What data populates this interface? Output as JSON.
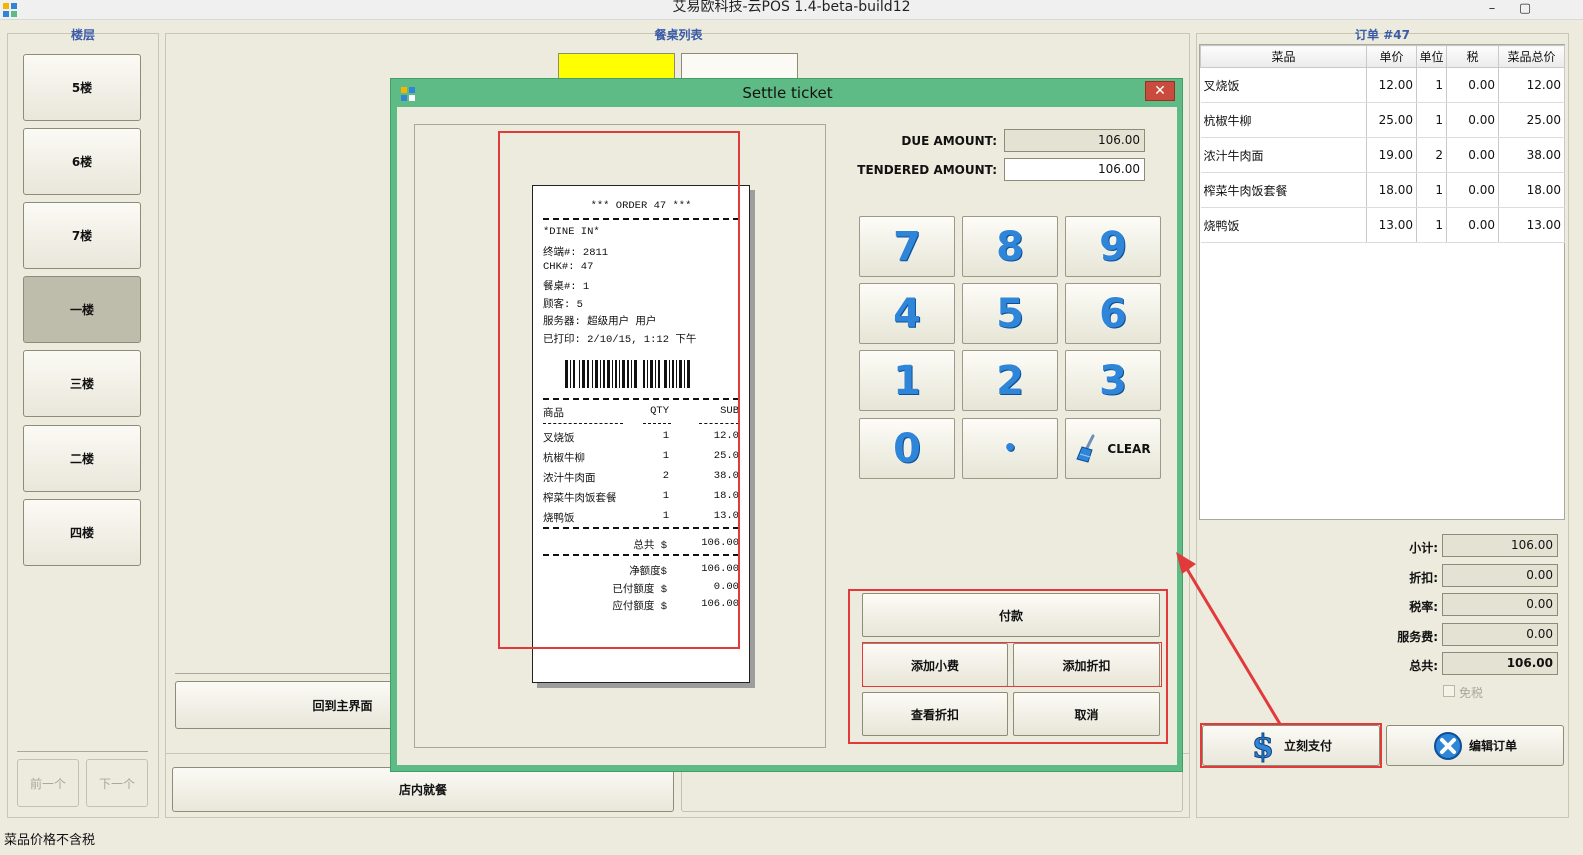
{
  "window": {
    "title": "艾易欧科技-云POS 1.4-beta-build12"
  },
  "floors": {
    "title": "楼层",
    "items": [
      "5楼",
      "6楼",
      "7楼",
      "一楼",
      "三楼",
      "二楼",
      "四楼"
    ],
    "prev_label": "前一个",
    "next_label": "下一个"
  },
  "tables": {
    "title": "餐桌列表",
    "home_label": "回到主界面",
    "dine_in_label": "店内就餐"
  },
  "order": {
    "title": "订单 #47",
    "columns": [
      "菜品",
      "单价",
      "单位",
      "税",
      "菜品总价"
    ],
    "rows": [
      {
        "name": "叉烧饭",
        "price": "12.00",
        "qty": "1",
        "tax": "0.00",
        "total": "12.00"
      },
      {
        "name": "杭椒牛柳",
        "price": "25.00",
        "qty": "1",
        "tax": "0.00",
        "total": "25.00"
      },
      {
        "name": "浓汁牛肉面",
        "price": "19.00",
        "qty": "2",
        "tax": "0.00",
        "total": "38.00"
      },
      {
        "name": "榨菜牛肉饭套餐",
        "price": "18.00",
        "qty": "1",
        "tax": "0.00",
        "total": "18.00"
      },
      {
        "name": "烧鸭饭",
        "price": "13.00",
        "qty": "1",
        "tax": "0.00",
        "total": "13.00"
      }
    ],
    "summary": {
      "subtotal_label": "小计:",
      "subtotal": "106.00",
      "discount_label": "折扣:",
      "discount": "0.00",
      "tax_label": "税率:",
      "tax": "0.00",
      "service_label": "服务费:",
      "service": "0.00",
      "total_label": "总共:",
      "total": "106.00"
    },
    "tax_exempt_label": "免税",
    "pay_now_label": "立刻支付",
    "edit_order_label": "编辑订单"
  },
  "dialog": {
    "title": "Settle ticket",
    "close_glyph": "✕",
    "due_label": "DUE AMOUNT:",
    "due_value": "106.00",
    "tendered_label": "TENDERED AMOUNT:",
    "tendered_value": "106.00",
    "keys": [
      "7",
      "8",
      "9",
      "4",
      "5",
      "6",
      "1",
      "2",
      "3",
      "0",
      "•"
    ],
    "clear_label": "CLEAR",
    "pay_label": "付款",
    "add_tip_label": "添加小费",
    "add_discount_label": "添加折扣",
    "view_discount_label": "查看折扣",
    "cancel_label": "取消"
  },
  "receipt": {
    "header": "*** ORDER 47 ***",
    "order_type": "*DINE IN*",
    "terminal": "终端#: 2811",
    "check": "CHK#: 47",
    "table": "餐桌#: 1",
    "guests": "顾客: 5",
    "server": "服务器: 超级用户 用户",
    "printed": "已打印: 2/10/15, 1:12 下午",
    "col_item": "商品",
    "col_qty": "QTY",
    "col_sub": "SUB",
    "items": [
      {
        "name": "叉烧饭",
        "qty": "1",
        "sub": "12.0"
      },
      {
        "name": "杭椒牛柳",
        "qty": "1",
        "sub": "25.0"
      },
      {
        "name": "浓汁牛肉面",
        "qty": "2",
        "sub": "38.0"
      },
      {
        "name": "榨菜牛肉饭套餐",
        "qty": "1",
        "sub": "18.0"
      },
      {
        "name": "烧鸭饭",
        "qty": "1",
        "sub": "13.0"
      }
    ],
    "total_label": "总共 $",
    "total": "106.00",
    "net_label": "净额度$",
    "net": "106.00",
    "paid_label": "已付额度 $",
    "paid": "0.00",
    "due_label": "应付额度 $",
    "due": "106.00"
  },
  "status": {
    "text": "菜品价格不含税"
  },
  "colors": {
    "dialog_frame": "#5fbb86",
    "highlight": "#e23a3a",
    "table_yellow": "#ffff00",
    "accent_blue": "#3b5ba8"
  }
}
